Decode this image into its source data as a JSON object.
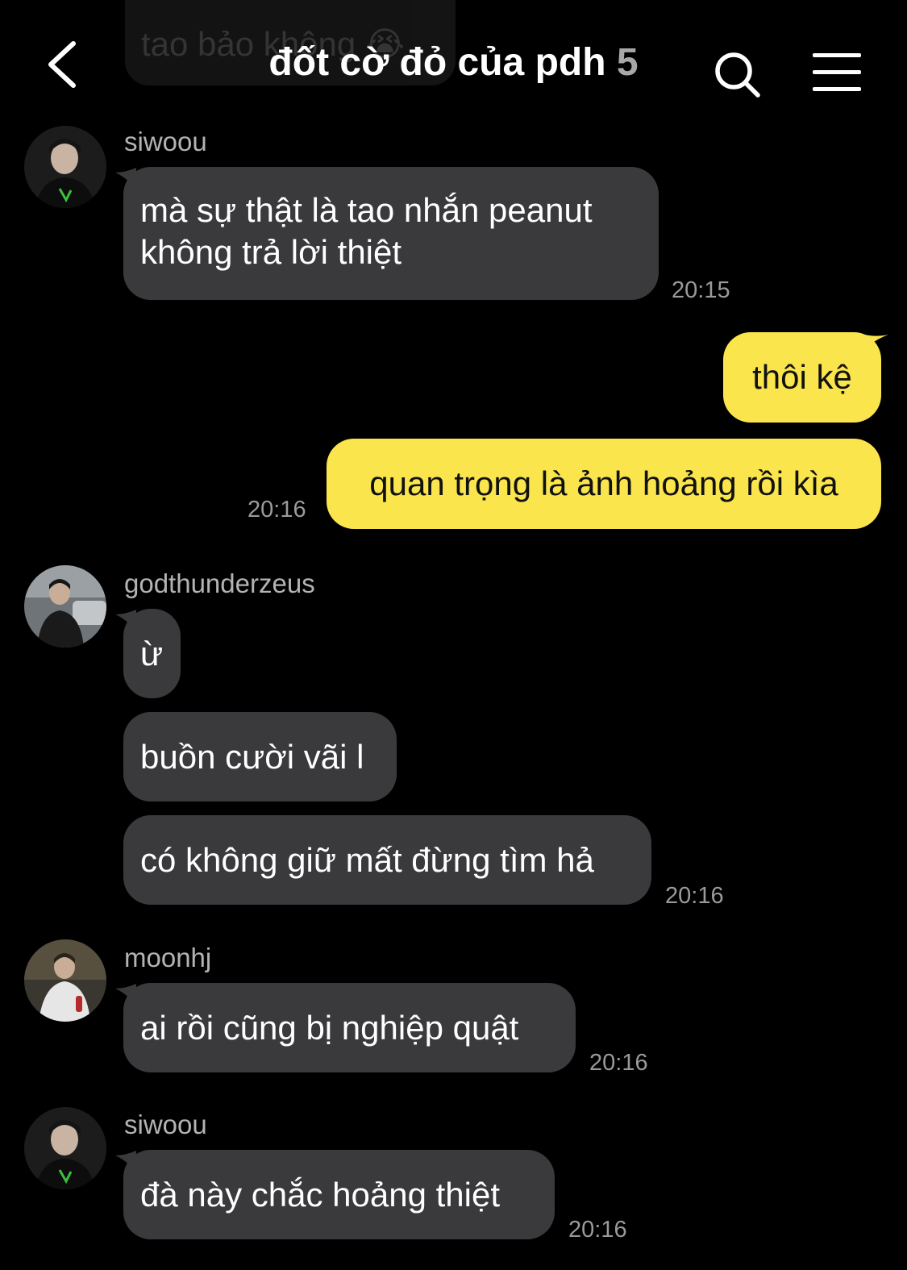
{
  "header": {
    "title": "đốt cờ đỏ của pdh",
    "member_count": "5",
    "back_icon": "chevron-left-icon",
    "search_icon": "search-icon",
    "menu_icon": "hamburger-menu-icon"
  },
  "colors": {
    "background": "#000000",
    "incoming_bubble": "#3a3a3c",
    "outgoing_bubble": "#fbe54d",
    "timestamp": "#9a9a9a",
    "sender_name": "#b3b3b3"
  },
  "faded_message": "tao bảo không 😭",
  "messages": {
    "m1": {
      "sender": "siwoou",
      "line1": "mà sự thật là tao nhắn peanut",
      "line2": "không trả lời thiệt",
      "time": "20:15"
    },
    "m2": {
      "text": "thôi kệ"
    },
    "m3": {
      "text": "quan trọng là ảnh hoảng rồi kìa",
      "time": "20:16"
    },
    "m4": {
      "sender": "godthunderzeus",
      "text": "ừ"
    },
    "m5": {
      "text": "buồn cười vãi l"
    },
    "m6": {
      "text": "có không giữ mất đừng tìm hả",
      "time": "20:16"
    },
    "m7": {
      "sender": "moonhj",
      "text": "ai rồi cũng bị nghiệp quật",
      "time": "20:16"
    },
    "m8": {
      "sender": "siwoou",
      "text": "đà này chắc hoảng thiệt",
      "time": "20:16"
    }
  }
}
